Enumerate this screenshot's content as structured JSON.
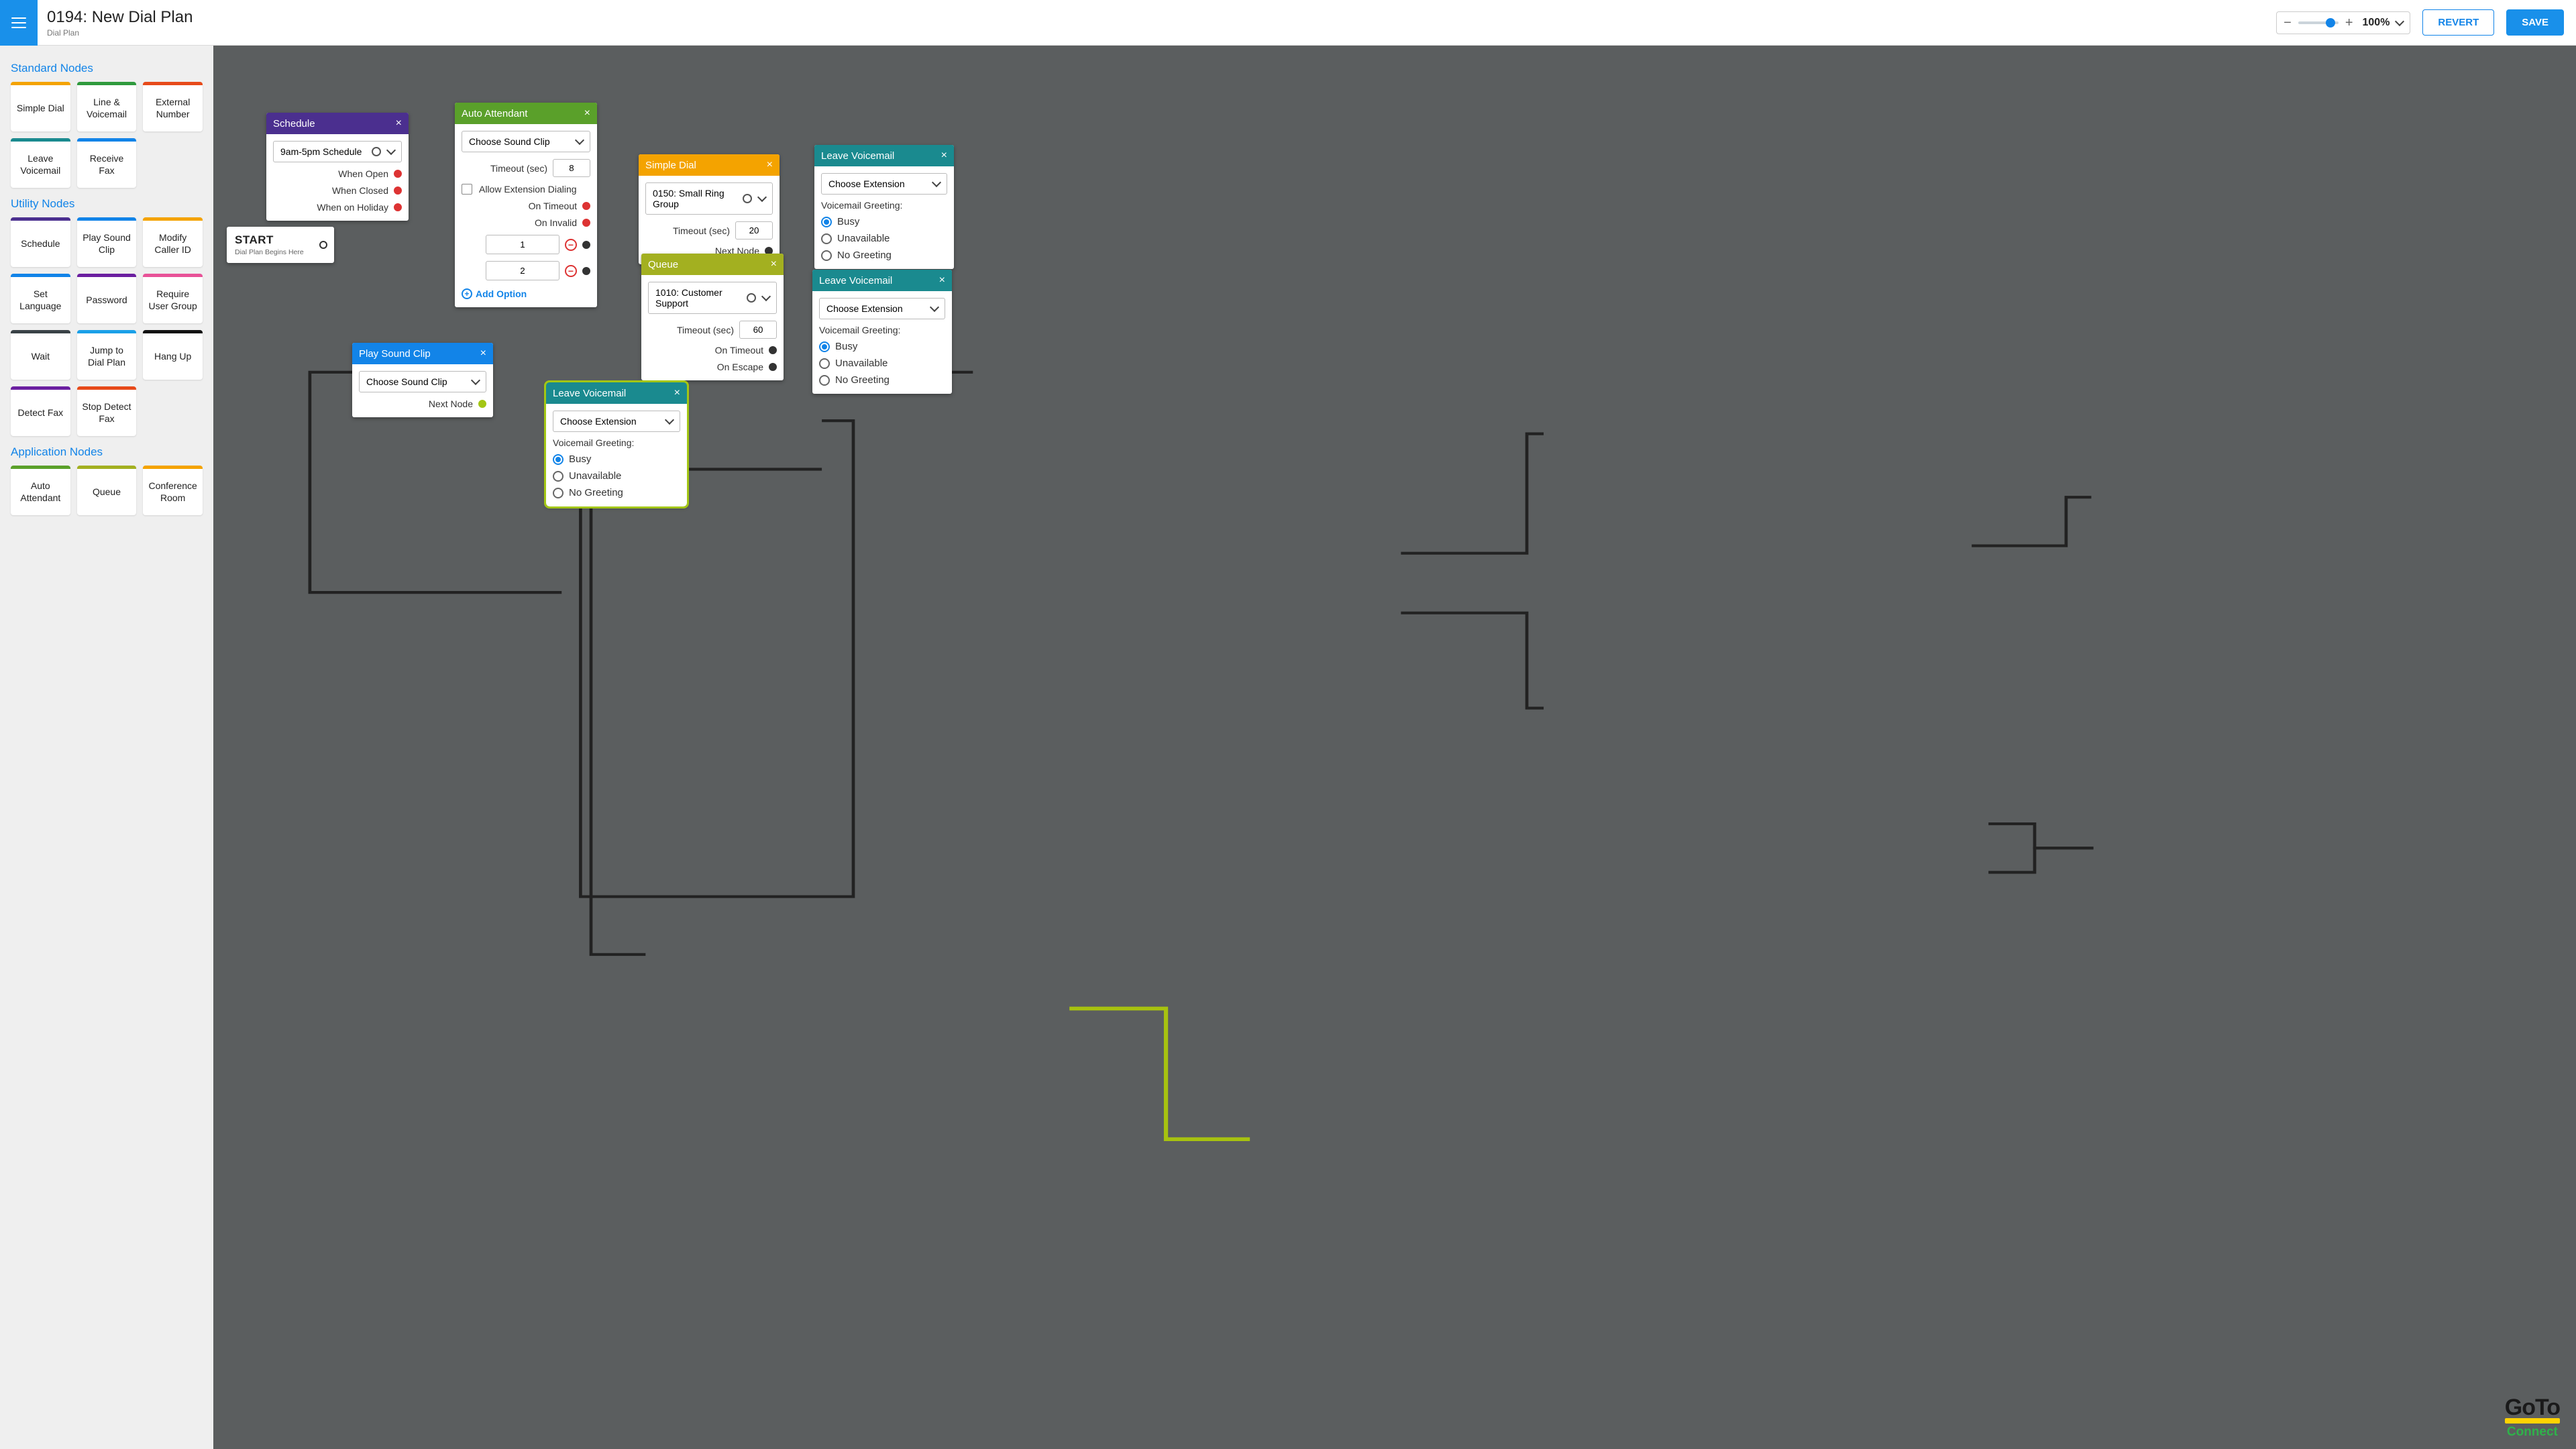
{
  "header": {
    "title": "0194: New Dial Plan",
    "subtitle": "Dial Plan",
    "zoom_value": "100%",
    "revert": "REVERT",
    "save": "SAVE"
  },
  "sidebar": {
    "standard_h": "Standard Nodes",
    "utility_h": "Utility Nodes",
    "application_h": "Application Nodes",
    "standard": [
      {
        "label": "Simple Dial",
        "color": "#f4a300"
      },
      {
        "label": "Line & Voicemail",
        "color": "#2f9a3d"
      },
      {
        "label": "External Number",
        "color": "#e74a1a"
      },
      {
        "label": "Leave Voicemail",
        "color": "#1a8a8f"
      },
      {
        "label": "Receive Fax",
        "color": "#1284e8"
      }
    ],
    "utility": [
      {
        "label": "Schedule",
        "color": "#4b2f8f"
      },
      {
        "label": "Play Sound Clip",
        "color": "#1284e8"
      },
      {
        "label": "Modify Caller ID",
        "color": "#f4a300"
      },
      {
        "label": "Set Language",
        "color": "#1284e8"
      },
      {
        "label": "Password",
        "color": "#6b1fa0"
      },
      {
        "label": "Require User Group",
        "color": "#e85298"
      },
      {
        "label": "Wait",
        "color": "#3a4247"
      },
      {
        "label": "Jump to Dial Plan",
        "color": "#1aa0e8"
      },
      {
        "label": "Hang Up",
        "color": "#111"
      },
      {
        "label": "Detect Fax",
        "color": "#6b1fa0"
      },
      {
        "label": "Stop Detect Fax",
        "color": "#e74a1a"
      }
    ],
    "application": [
      {
        "label": "Auto Attendant",
        "color": "#5aa02a"
      },
      {
        "label": "Queue",
        "color": "#a3b020"
      },
      {
        "label": "Conference Room",
        "color": "#f4a300"
      }
    ]
  },
  "start": {
    "title": "START",
    "subtitle": "Dial Plan Begins Here"
  },
  "schedule": {
    "title": "Schedule",
    "value": "9am-5pm Schedule",
    "rows": [
      "When Open",
      "When Closed",
      "When on Holiday"
    ]
  },
  "auto_attendant": {
    "title": "Auto Attendant",
    "sound": "Choose Sound Clip",
    "timeout_label": "Timeout (sec)",
    "timeout_value": "8",
    "allow_ext": "Allow Extension Dialing",
    "on_timeout": "On Timeout",
    "on_invalid": "On Invalid",
    "opt1": "1",
    "opt2": "2",
    "add_option": "Add Option"
  },
  "simple_dial": {
    "title": "Simple Dial",
    "value": "0150: Small Ring Group",
    "timeout_label": "Timeout (sec)",
    "timeout_value": "20",
    "next_node": "Next Node"
  },
  "queue": {
    "title": "Queue",
    "value": "1010: Customer Support",
    "timeout_label": "Timeout (sec)",
    "timeout_value": "60",
    "on_timeout": "On Timeout",
    "on_escape": "On Escape"
  },
  "play_sound": {
    "title": "Play Sound Clip",
    "value": "Choose Sound Clip",
    "next_node": "Next Node"
  },
  "voicemail_common": {
    "title": "Leave Voicemail",
    "ext": "Choose Extension",
    "greet_label": "Voicemail Greeting:",
    "opts": [
      "Busy",
      "Unavailable",
      "No Greeting"
    ]
  },
  "branding": {
    "line1": "GoTo",
    "line2": "Connect"
  }
}
